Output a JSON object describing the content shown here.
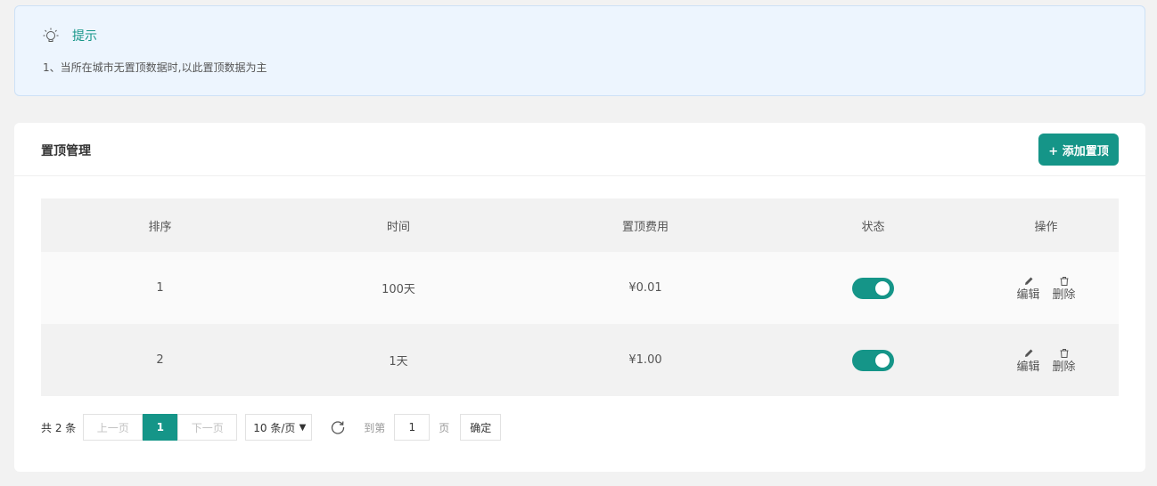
{
  "tip": {
    "icon": "lightbulb-icon",
    "title": "提示",
    "line": "1、当所在城市无置顶数据时,以此置顶数据为主"
  },
  "card": {
    "title": "置顶管理",
    "add_button": "+ 添加置顶",
    "accent": "#159588"
  },
  "table": {
    "headers": [
      "排序",
      "时间",
      "置顶费用",
      "状态",
      "操作"
    ],
    "rows": [
      {
        "order": "1",
        "time": "100天",
        "fee": "¥0.01",
        "status_on": true,
        "edit": "编辑",
        "delete": "删除"
      },
      {
        "order": "2",
        "time": "1天",
        "fee": "¥1.00",
        "status_on": true,
        "edit": "编辑",
        "delete": "删除"
      }
    ]
  },
  "pager": {
    "total": "共 2 条",
    "prev": "上一页",
    "current": "1",
    "next": "下一页",
    "page_size": "10 条/页",
    "goto": "到第",
    "goto_value": "1",
    "page_unit": "页",
    "confirm": "确定"
  }
}
